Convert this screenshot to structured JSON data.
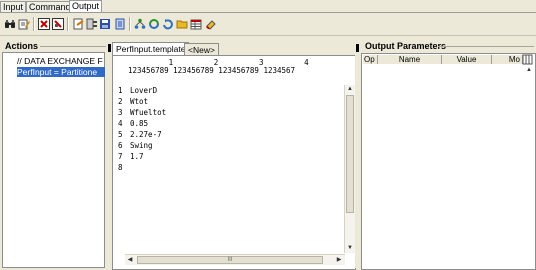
{
  "tabs": [
    "Input",
    "Command",
    "Output"
  ],
  "active_tab": "Output",
  "toolbar_icons": [
    "binoculars-icon",
    "edit-icon",
    "stop-icon",
    "stop-icon-2",
    "new-doc-icon",
    "align-icon",
    "save-icon",
    "copy-icon",
    "tree-icon",
    "refresh-icon",
    "reload-icon",
    "folder-icon",
    "table-icon",
    "clear-icon"
  ],
  "actions": {
    "title": "Actions",
    "items": [
      "// DATA EXCHANGE F",
      "PerfInput = Partitione"
    ]
  },
  "editor": {
    "tabs": [
      "PerfInput.template",
      "<New>"
    ],
    "ruler_top": "         1         2         3         4",
    "ruler_bottom": "123456789 123456789 123456789 1234567",
    "lines": [
      {
        "no": "1",
        "text": "LoverD"
      },
      {
        "no": "2",
        "text": "Wtot"
      },
      {
        "no": "3",
        "text": "Wfueltot"
      },
      {
        "no": "4",
        "text": "0.85"
      },
      {
        "no": "5",
        "text": "2.27e-7"
      },
      {
        "no": "6",
        "text": "Swing"
      },
      {
        "no": "7",
        "text": "1.7"
      },
      {
        "no": "8",
        "text": ""
      }
    ],
    "h_thumb_marker": "III"
  },
  "output": {
    "title": "Output Parameters",
    "columns": [
      "Op",
      "Name",
      "Value",
      "Mo"
    ]
  },
  "colors": {
    "selection": "#3169c6",
    "window_bg": "#ece9d8"
  }
}
